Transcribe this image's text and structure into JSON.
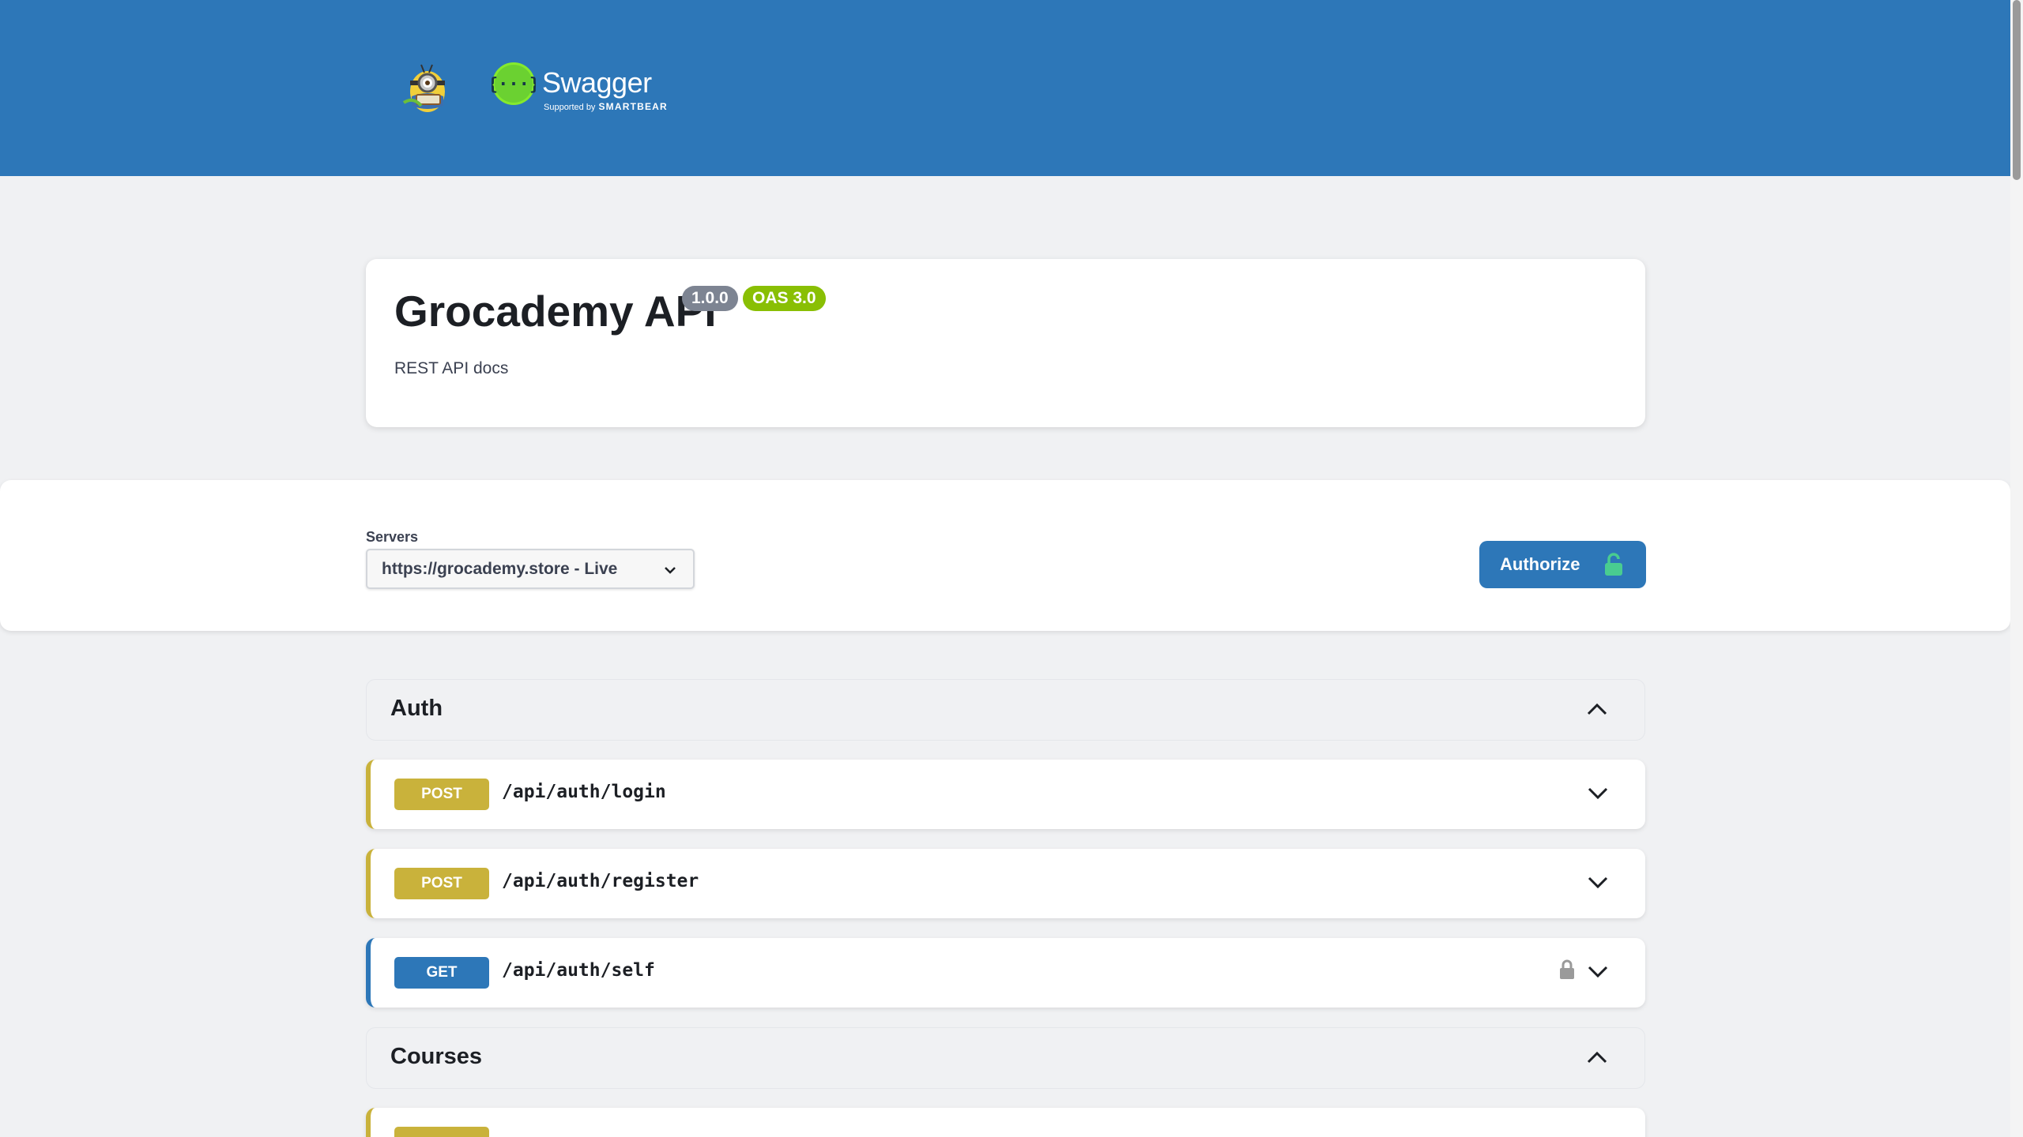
{
  "topbar": {
    "brand_name": "Swagger",
    "brand_supported_by": "Supported by",
    "brand_company": "SMARTBEAR",
    "logo_icon": "swagger-braces-icon",
    "mascot_icon": "minion-mascot-icon",
    "color": "#2d77b8"
  },
  "info": {
    "title": "Grocademy API",
    "version": "1.0.0",
    "oas": "OAS 3.0",
    "description": "REST API docs"
  },
  "scheme": {
    "servers_label": "Servers",
    "selected_server": "https://grocademy.store - Live",
    "authorize_label": "Authorize",
    "authorize_icon": "lock-open-icon"
  },
  "tags": [
    {
      "name": "Auth",
      "expanded": true,
      "operations": [
        {
          "method": "POST",
          "path": "/api/auth/login",
          "locked": false
        },
        {
          "method": "POST",
          "path": "/api/auth/register",
          "locked": false
        },
        {
          "method": "GET",
          "path": "/api/auth/self",
          "locked": true
        }
      ]
    },
    {
      "name": "Courses",
      "expanded": true,
      "operations": []
    }
  ],
  "colors": {
    "post": "#c9b23b",
    "get": "#2d77b8",
    "authorize_lock": "#49cc90"
  }
}
